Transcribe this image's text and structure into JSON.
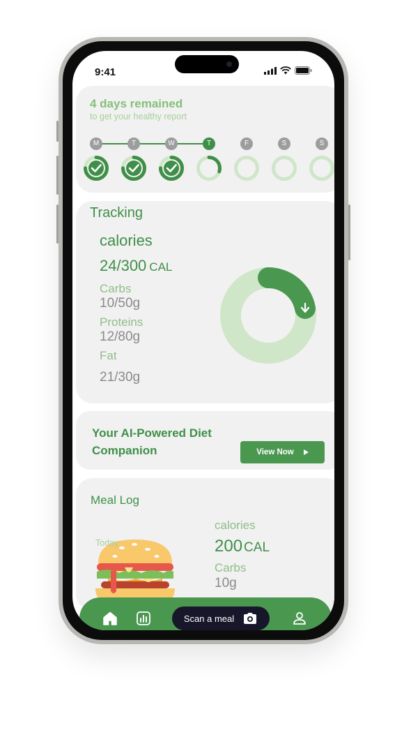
{
  "status_bar": {
    "time": "9:41"
  },
  "streak": {
    "title": "4 days  remained",
    "subtitle": "to get your healthy report",
    "days": [
      {
        "letter": "M",
        "progress": 1.0,
        "done": true
      },
      {
        "letter": "T",
        "progress": 1.0,
        "done": true
      },
      {
        "letter": "W",
        "progress": 1.0,
        "done": true
      },
      {
        "letter": "T",
        "progress": 0.3,
        "done": false
      },
      {
        "letter": "F",
        "progress": 0,
        "done": false
      },
      {
        "letter": "S",
        "progress": 0,
        "done": false
      },
      {
        "letter": "S",
        "progress": 0,
        "done": false
      }
    ]
  },
  "tracking": {
    "title": "Tracking",
    "calories_label": "calories",
    "calories_value": "24/300",
    "calories_unit": "CAL",
    "carbs_label": "Carbs",
    "carbs_value": "10/50g",
    "proteins_label": "Proteins",
    "proteins_value": "12/80g",
    "fat_label": "Fat",
    "fat_value": "21/30g",
    "chart_progress": 0.22
  },
  "promo": {
    "text": "Your  AI-Powered Diet Companion",
    "button_label": "View Now"
  },
  "meal_log": {
    "title": "Meal Log",
    "date_label": "Today",
    "calories_label": "calories",
    "calories_value": "200",
    "calories_unit": "CAL",
    "carbs_label": "Carbs",
    "carbs_value": "10g"
  },
  "nav": {
    "scan_label": "Scan a meal",
    "icons": [
      "home-icon",
      "stats-icon",
      "camera-icon",
      "profile-icon"
    ]
  },
  "colors": {
    "primary": "#4a9750",
    "light_green": "#8ebf86",
    "card": "#f1f1f1",
    "scan_button": "#17162a"
  }
}
